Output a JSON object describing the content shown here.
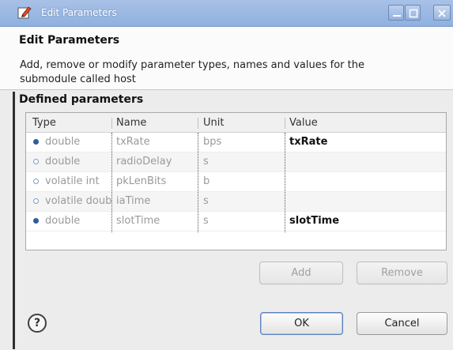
{
  "window": {
    "title": "Edit Parameters"
  },
  "header": {
    "title": "Edit Parameters",
    "description": "Add, remove or modify parameter types, names and values for the submodule called host"
  },
  "section": {
    "label": "Defined parameters"
  },
  "table": {
    "columns": [
      "Type",
      "Name",
      "Unit",
      "Value"
    ],
    "rows": [
      {
        "type": "double",
        "name": "txRate",
        "unit": "bps",
        "value": "txRate",
        "marker": "filled"
      },
      {
        "type": "double",
        "name": "radioDelay",
        "unit": "s",
        "value": "",
        "marker": "hollow"
      },
      {
        "type": "volatile int",
        "name": "pkLenBits",
        "unit": "b",
        "value": "",
        "marker": "hollow"
      },
      {
        "type": "volatile doub",
        "name": "iaTime",
        "unit": "s",
        "value": "",
        "marker": "hollow"
      },
      {
        "type": "double",
        "name": "slotTime",
        "unit": "s",
        "value": "slotTime",
        "marker": "filled"
      }
    ]
  },
  "buttons": {
    "add": "Add",
    "remove": "Remove",
    "ok": "OK",
    "cancel": "Cancel",
    "help": "?"
  },
  "icons": {
    "app": "edit-parameters-icon",
    "minimize": "minimize-icon",
    "maximize": "maximize-icon",
    "close": "close-icon",
    "help": "help-icon"
  },
  "colors": {
    "titlebar": "#9bb7e2",
    "filled_marker": "#2d5d9e",
    "hollow_marker": "#7a9cc9"
  }
}
